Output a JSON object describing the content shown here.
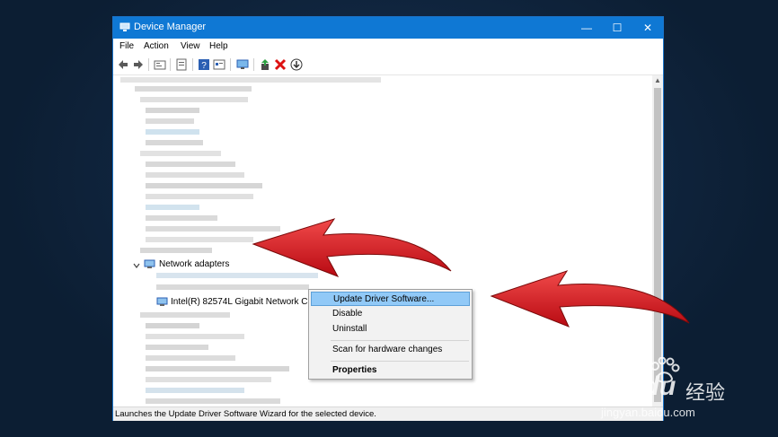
{
  "window": {
    "title": "Device Manager",
    "controls": {
      "minimize": "—",
      "maximize": "☐",
      "close": "✕"
    }
  },
  "menu": [
    "File",
    "Action",
    "View",
    "Help"
  ],
  "tree": {
    "network_adapters_label": "Network adapters",
    "selected_device_label": "Intel(R) 82574L Gigabit Network Connection"
  },
  "context_menu": {
    "update_driver": "Update Driver Software...",
    "disable": "Disable",
    "uninstall": "Uninstall",
    "scan": "Scan for hardware changes",
    "properties": "Properties"
  },
  "status_text": "Launches the Update Driver Software Wizard for the selected device.",
  "watermark": {
    "brand": "Baidu",
    "cn": "经验",
    "url": "jingyan.baidu.com"
  },
  "colors": {
    "titlebar": "#0f78d4",
    "highlight": "#91c9f7",
    "arrow": "#d8121b"
  },
  "toolbar_icons": [
    "back-arrow-icon",
    "forward-arrow-icon",
    "properties-icon",
    "tree-view-icon",
    "help-icon",
    "resources-icon",
    "monitor-icon",
    "update-driver-icon",
    "uninstall-x-icon",
    "scan-download-icon"
  ]
}
